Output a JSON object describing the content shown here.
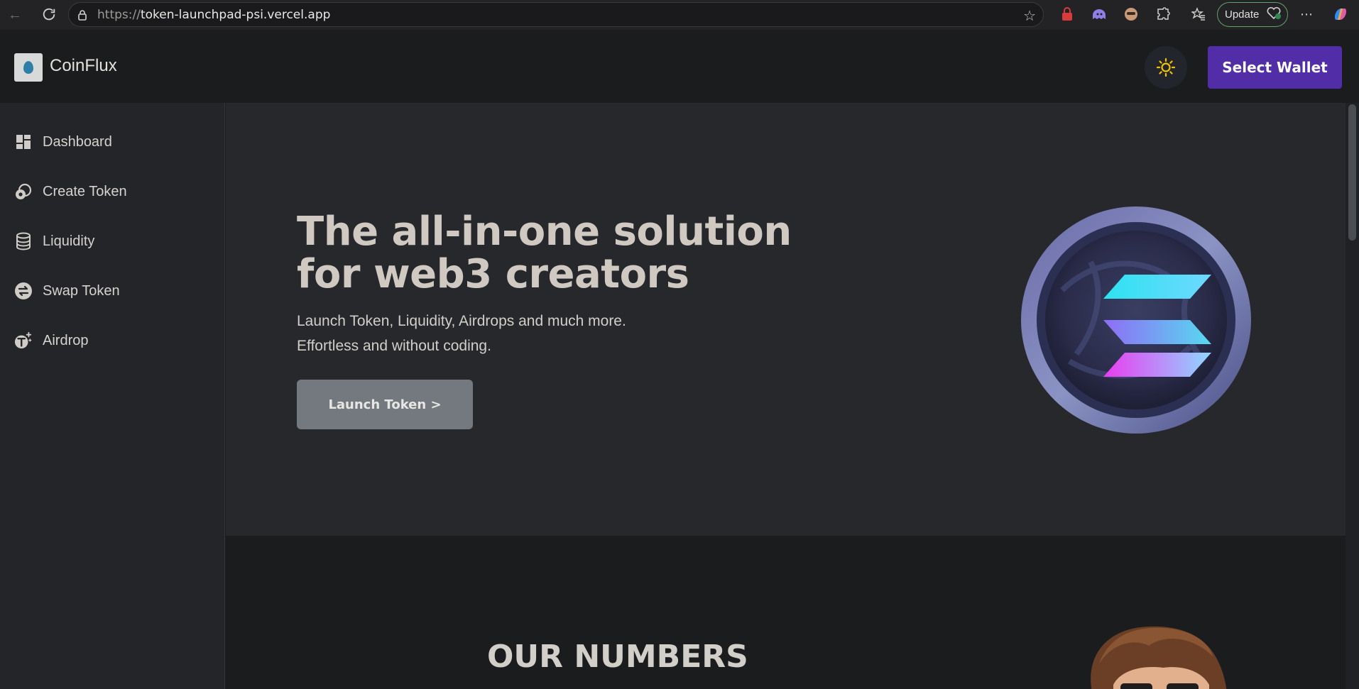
{
  "browser": {
    "url_scheme": "https://",
    "url_host": "token-launchpad-psi.vercel.app",
    "update_label": "Update"
  },
  "header": {
    "brand": "CoinFlux",
    "wallet_button": "Select Wallet"
  },
  "sidebar": {
    "items": [
      {
        "label": "Dashboard",
        "icon": "dashboard-icon"
      },
      {
        "label": "Create Token",
        "icon": "create-token-icon"
      },
      {
        "label": "Liquidity",
        "icon": "database-icon"
      },
      {
        "label": "Swap Token",
        "icon": "swap-icon"
      },
      {
        "label": "Airdrop",
        "icon": "airdrop-icon"
      }
    ]
  },
  "hero": {
    "title": "The all-in-one solution for web3 creators",
    "subtitle_line1": "Launch Token, Liquidity, Airdrops and much more.",
    "subtitle_line2": "Effortless and without coding.",
    "cta": "Launch Token >"
  },
  "numbers": {
    "title": "OUR NUMBERS"
  },
  "colors": {
    "accent": "#512da8",
    "sun": "#f2c400"
  }
}
